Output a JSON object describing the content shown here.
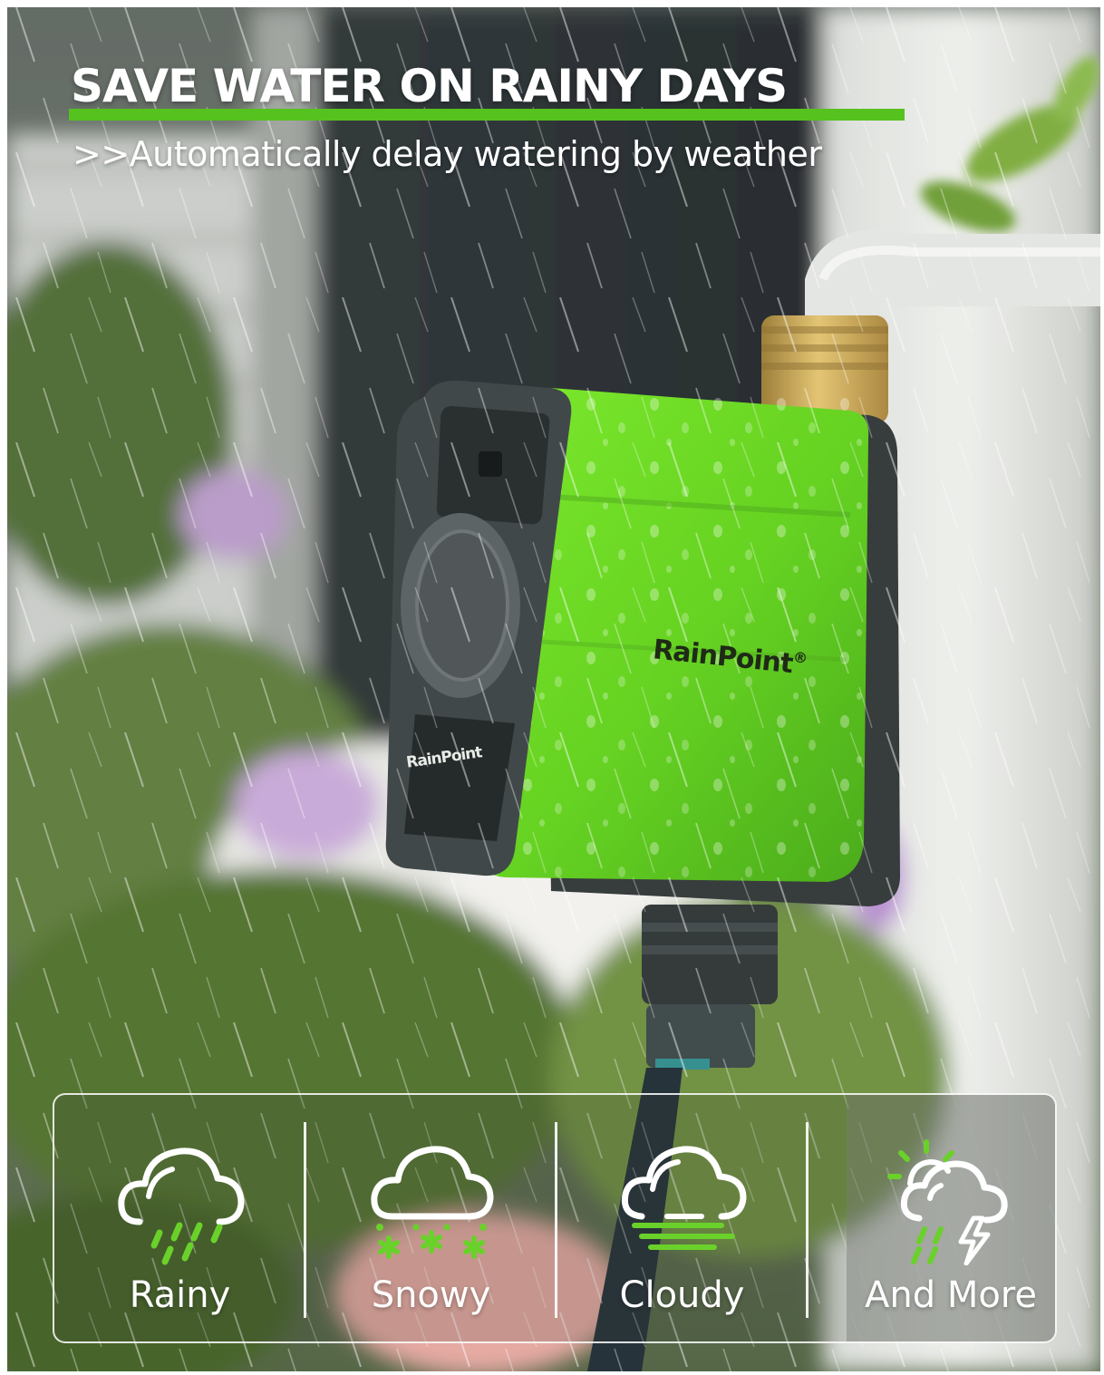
{
  "headline": "SAVE WATER ON RAINY DAYS",
  "subhead": ">>Automatically delay watering by weather",
  "brand": {
    "body_logo": "RainPoint",
    "panel_logo": "RainPoint",
    "registered_mark": "®"
  },
  "weather_modes": [
    {
      "label": "Rainy",
      "icon": "cloud-rain-icon"
    },
    {
      "label": "Snowy",
      "icon": "cloud-snow-icon"
    },
    {
      "label": "Cloudy",
      "icon": "cloud-wind-icon"
    },
    {
      "label": "And More",
      "icon": "sun-cloud-storm-icon"
    }
  ],
  "colors": {
    "accent_green": "#55c21f",
    "timer_green": "#63d61a",
    "timer_dark": "#2e3434",
    "brass": "#c4a046",
    "text_white": "#ffffff"
  }
}
